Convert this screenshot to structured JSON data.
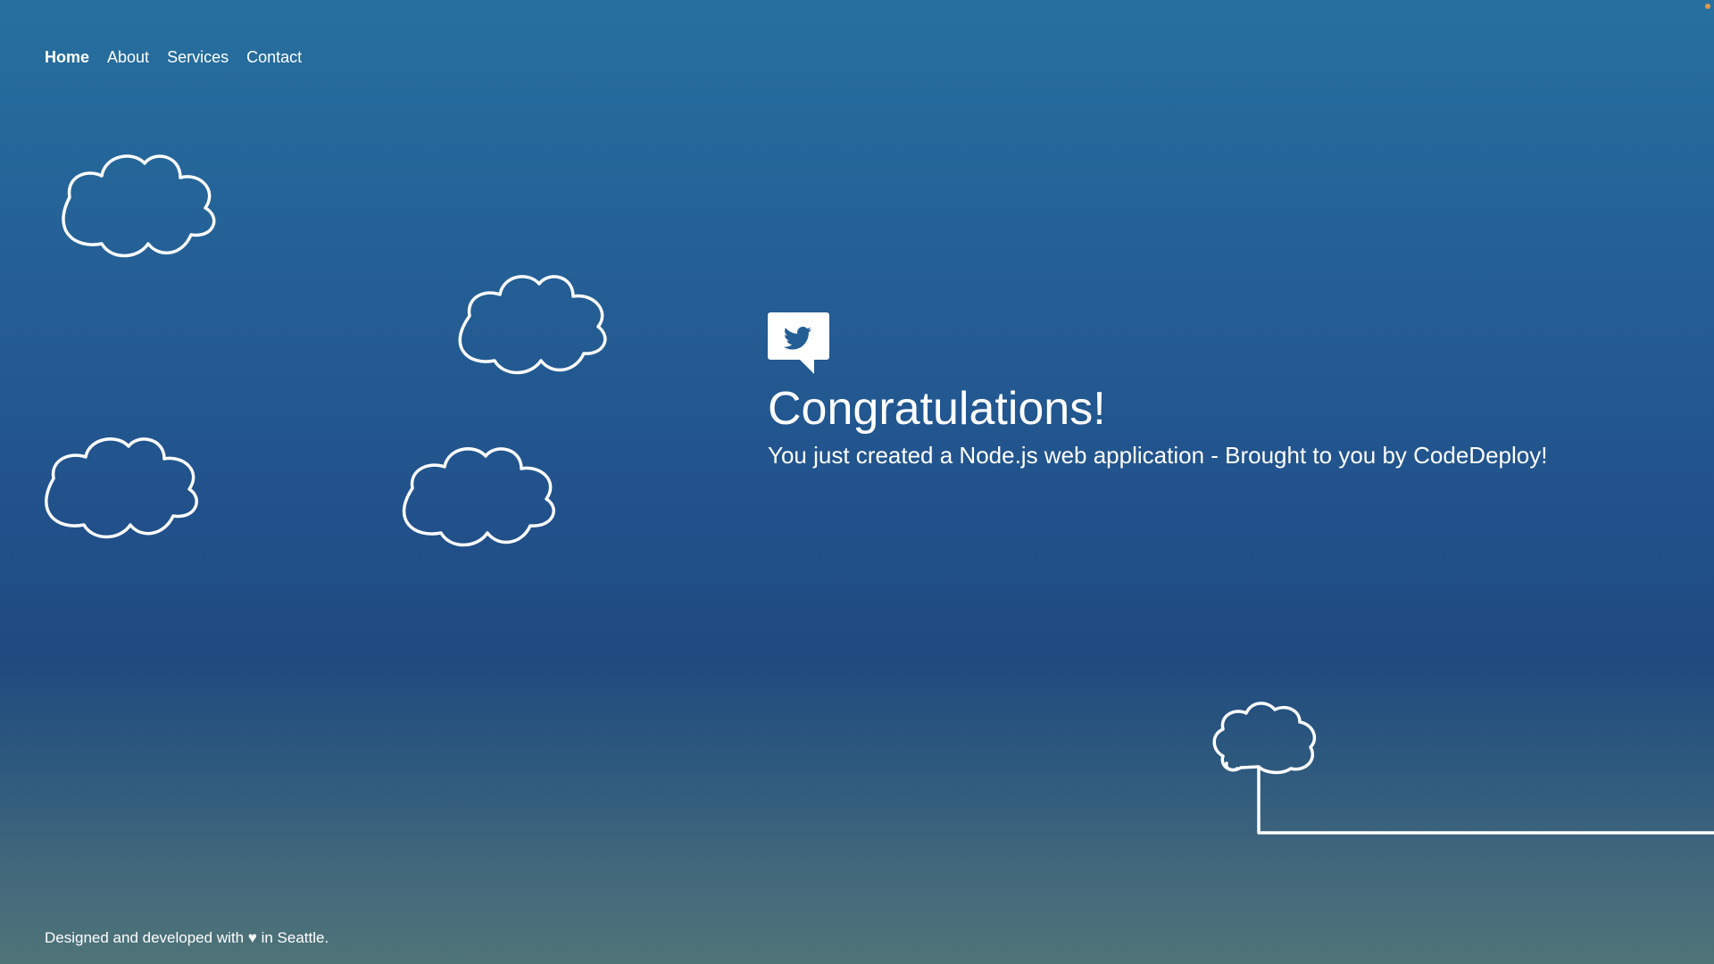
{
  "nav": {
    "items": [
      {
        "label": "Home",
        "active": true
      },
      {
        "label": "About",
        "active": false
      },
      {
        "label": "Services",
        "active": false
      },
      {
        "label": "Contact",
        "active": false
      }
    ]
  },
  "hero": {
    "icon": "twitter-bird-speech-bubble-icon",
    "title": "Congratulations!",
    "subtitle": "You just created a Node.js web application - Brought to you by CodeDeploy!"
  },
  "footer": {
    "text": "Designed and developed with ♥ in Seattle."
  },
  "colors": {
    "background_top": "#26709f",
    "background_middle": "#1f4a7f",
    "background_bottom": "#4f7478",
    "line_art": "#ffffff",
    "bird_icon": "#245e95"
  }
}
